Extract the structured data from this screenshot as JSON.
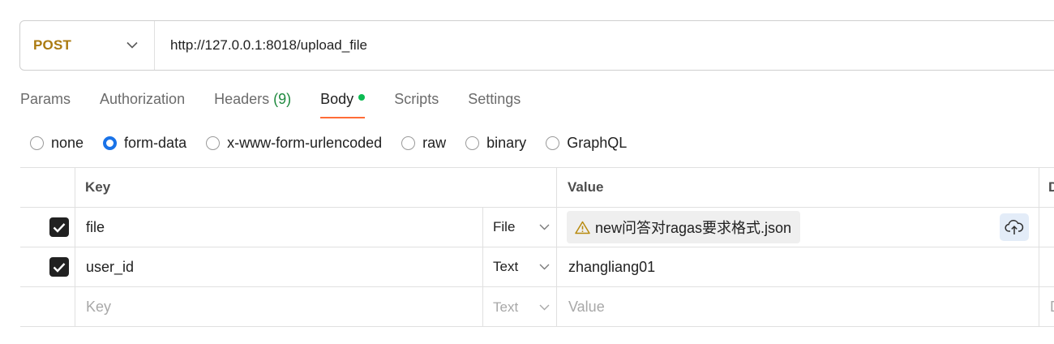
{
  "request": {
    "method": "POST",
    "url": "http://127.0.0.1:8018/upload_file"
  },
  "tabs": [
    {
      "label": "Params"
    },
    {
      "label": "Authorization"
    },
    {
      "label": "Headers",
      "count": "(9)"
    },
    {
      "label": "Body",
      "active": true
    },
    {
      "label": "Scripts"
    },
    {
      "label": "Settings"
    }
  ],
  "body_types": [
    {
      "label": "none"
    },
    {
      "label": "form-data",
      "selected": true
    },
    {
      "label": "x-www-form-urlencoded"
    },
    {
      "label": "raw"
    },
    {
      "label": "binary"
    },
    {
      "label": "GraphQL"
    }
  ],
  "table": {
    "headers": {
      "key": "Key",
      "value": "Value",
      "extra": "D"
    },
    "rows": [
      {
        "checked": true,
        "key": "file",
        "type": "File",
        "value": "new问答对ragas要求格式.json"
      },
      {
        "checked": true,
        "key": "user_id",
        "type": "Text",
        "value": "zhangliang01"
      }
    ],
    "new_row": {
      "key_placeholder": "Key",
      "type": "Text",
      "value_placeholder": "Value",
      "extra_placeholder": "D"
    }
  },
  "colors": {
    "method": "#ab7a10",
    "tab_underline": "#ff6c37",
    "body_dot": "#0cbb52",
    "headers_count": "#1f8a3f",
    "radio_selected": "#1a73e8",
    "warning": "#b88a0e"
  },
  "icons": {
    "method_dropdown": "chevron-down-icon",
    "file_warning": "warning-icon",
    "upload": "cloud-upload-icon",
    "checkbox": "check-icon"
  }
}
